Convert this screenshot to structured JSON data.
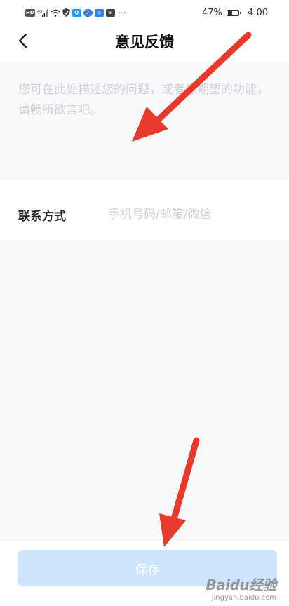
{
  "status_bar": {
    "left_icons": [
      "hd-icon",
      "signal-4g-icon",
      "wifi-icon",
      "shield-icon",
      "search-app-icon",
      "music-app-icon",
      "bulb-app-icon",
      "mail-app-icon",
      "more-dots-icon"
    ],
    "battery_percent": "47%",
    "battery_level": 0.47,
    "time": "4:00"
  },
  "nav": {
    "title": "意见反馈",
    "back_icon": "chevron-left-icon"
  },
  "feedback": {
    "placeholder": "您可在此处描述您的问题，或者您期望的功能，请畅所欲言吧。",
    "value": ""
  },
  "contact": {
    "label": "联系方式",
    "placeholder": "手机号码/邮箱/微信",
    "value": ""
  },
  "save_button": {
    "label": "保存",
    "enabled": false
  },
  "colors": {
    "accent_disabled": "#cde4fa",
    "annotation_arrow": "#e8392a",
    "placeholder": "#cfd2d8",
    "panel_bg": "#f8f9fb"
  },
  "watermark": {
    "logo": "Baidu经验",
    "sub": "jingyan.baidu.com"
  }
}
